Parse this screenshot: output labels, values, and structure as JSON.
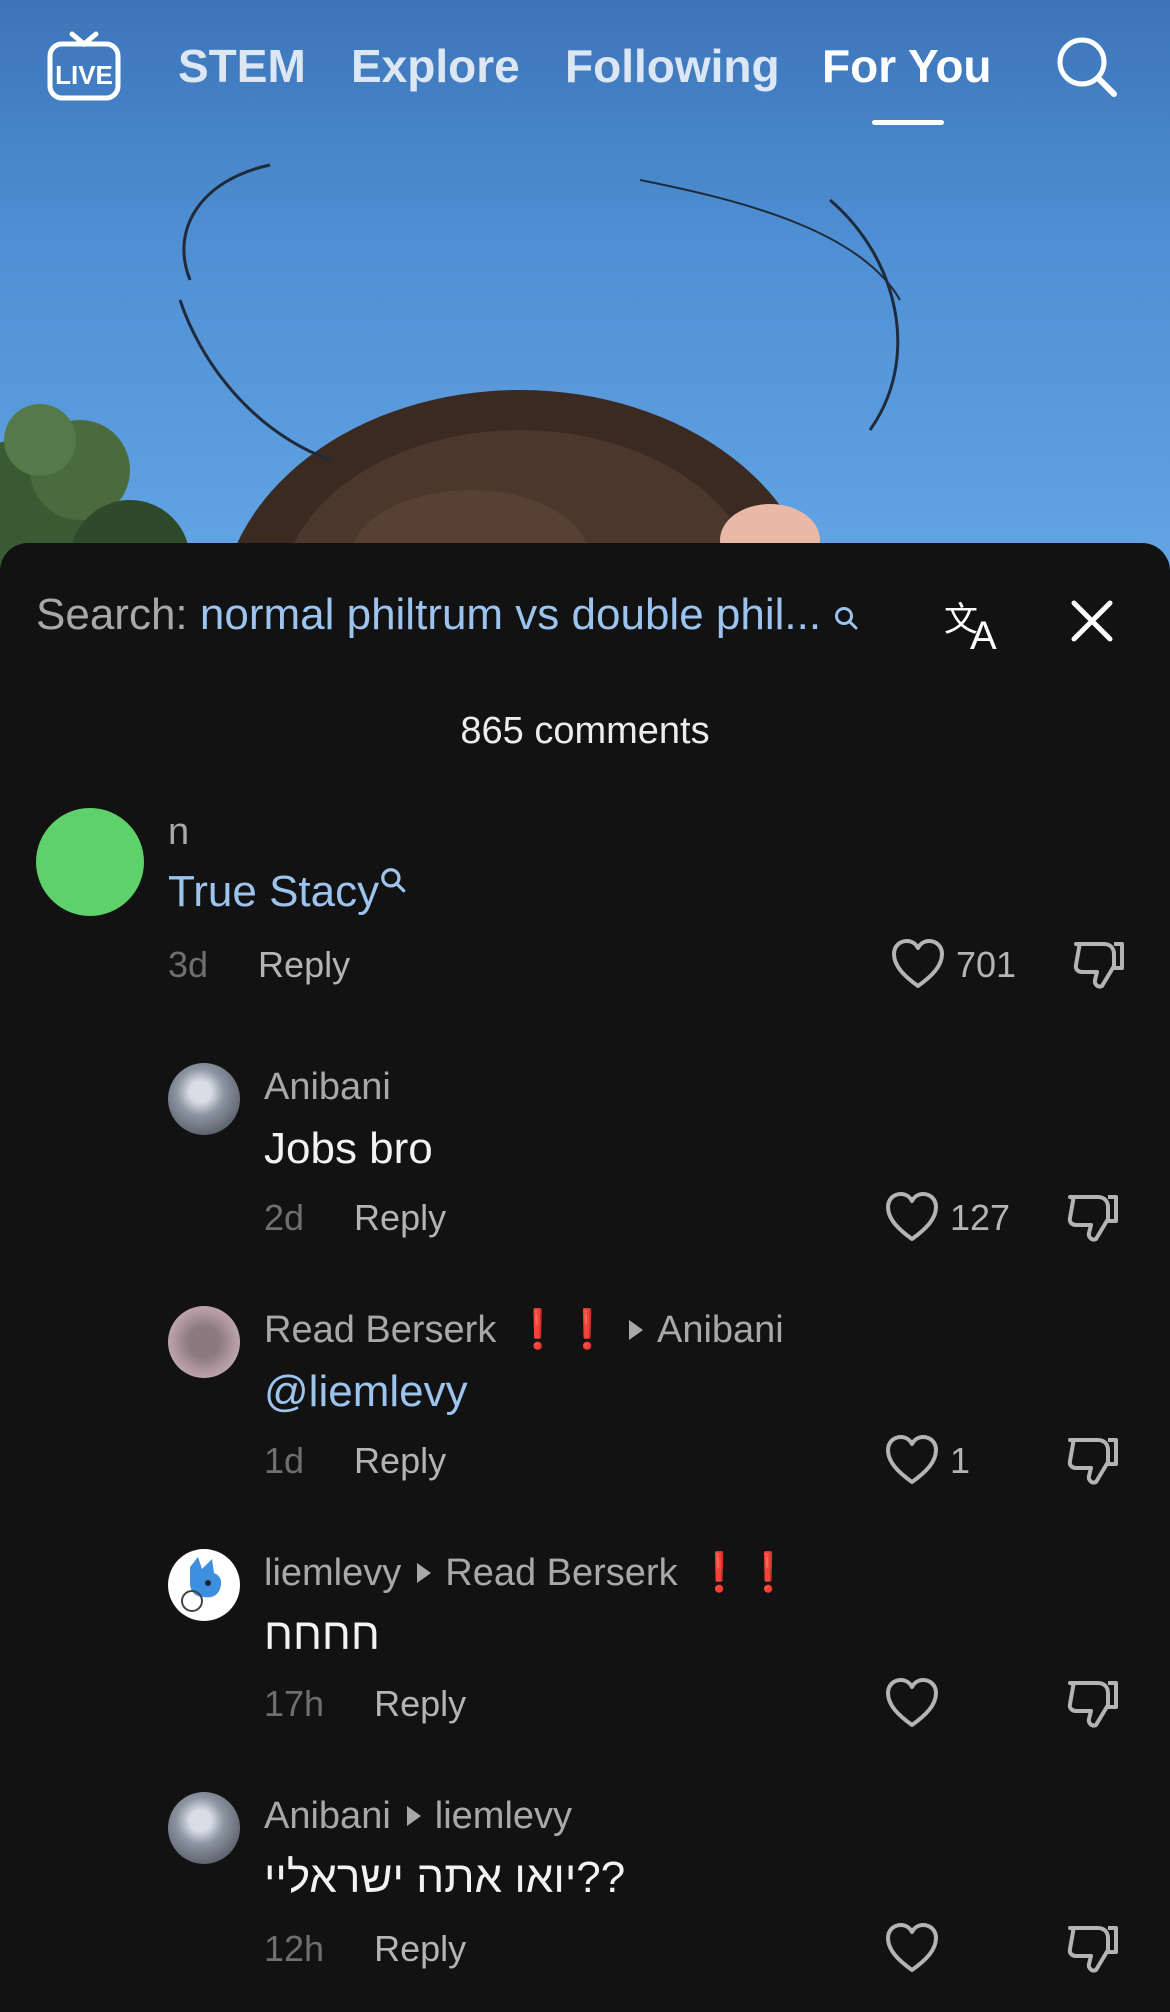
{
  "nav": {
    "tabs": [
      "STEM",
      "Explore",
      "Following",
      "For You"
    ],
    "active_tab": "For You",
    "icons": {
      "live": "live-tv-icon",
      "search": "search-icon"
    }
  },
  "sheet": {
    "search_label": "Search:",
    "search_term": "normal philtrum vs double phil...",
    "comment_count": "865 comments",
    "icons": {
      "translate": "translate-icon",
      "close": "close-icon"
    }
  },
  "colors": {
    "sheet_bg": "#121212",
    "link": "#9cc4ee",
    "badge_red": "#e01a1a",
    "avatar_green": "#5fd16a"
  },
  "comments": [
    {
      "user": "n",
      "text": "True Stacy",
      "is_search_link": true,
      "time": "3d",
      "reply": "Reply",
      "likes": "701"
    },
    {
      "user": "Anibani",
      "text": "Jobs bro",
      "time": "2d",
      "reply": "Reply",
      "likes": "127"
    },
    {
      "user": "Read Berserk",
      "badge": "❗❗",
      "reply_to": "Anibani",
      "text": "@liemlevy",
      "time": "1d",
      "reply": "Reply",
      "likes": "1"
    },
    {
      "user": "liemlevy",
      "reply_to": "Read Berserk",
      "reply_to_badge": "❗❗",
      "text": "חחחח",
      "time": "17h",
      "reply": "Reply",
      "likes": ""
    },
    {
      "user": "Anibani",
      "reply_to": "liemlevy",
      "text": "יואו אתה ישראליי??",
      "time": "12h",
      "reply": "Reply",
      "likes": ""
    }
  ]
}
